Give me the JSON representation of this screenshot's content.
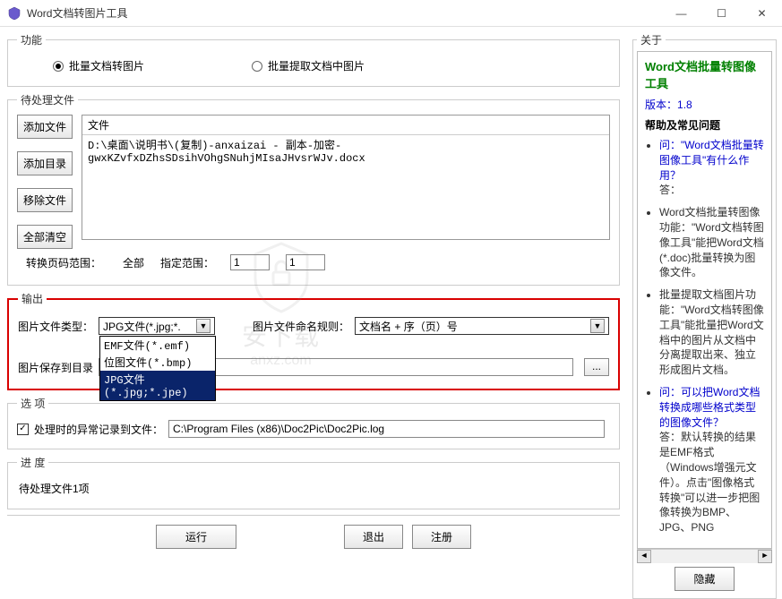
{
  "window": {
    "title": "Word文档转图片工具",
    "min": "—",
    "max": "☐",
    "close": "✕"
  },
  "mode": {
    "legend": "功能",
    "opt_convert": "批量文档转图片",
    "opt_extract": "批量提取文档中图片"
  },
  "pending": {
    "legend": "待处理文件",
    "add_file": "添加文件",
    "add_dir": "添加目录",
    "remove": "移除文件",
    "clear": "全部清空",
    "col_file": "文件",
    "file1": "D:\\桌面\\说明书\\(复制)-anxaizai - 副本-加密-gwxKZvfxDZhsSDsihVOhgSNuhjMIsaJHvsrWJv.docx"
  },
  "range": {
    "label": "转换页码范围：",
    "opt_all": "全部",
    "opt_spec": "指定范围：",
    "from": "1",
    "to": "1"
  },
  "output": {
    "legend": "输出",
    "type_label": "图片文件类型：",
    "type_value": "JPG文件(*.jpg;*.",
    "dd_emf": "EMF文件(*.emf)",
    "dd_bmp": "位图文件(*.bmp)",
    "dd_jpg": "JPG文件(*.jpg;*.jpe)",
    "rule_label": "图片文件命名规则：",
    "rule_value": "文档名 + 序（页）号",
    "savedir_label": "图片保存到目录",
    "savedir_value": "",
    "browse": "..."
  },
  "options": {
    "legend": "选  项",
    "chk_log": "处理时的异常记录到文件：",
    "log_path": "C:\\Program Files (x86)\\Doc2Pic\\Doc2Pic.log"
  },
  "progress": {
    "legend": "进  度",
    "text": "待处理文件1项"
  },
  "buttons": {
    "run": "运行",
    "exit": "退出",
    "register": "注册"
  },
  "about": {
    "legend": "关于",
    "title": "Word文档批量转图像工具",
    "version_label": "版本：",
    "version": "1.8",
    "help_section": "帮助及常见问题",
    "q1": "问：\"Word文档批量转图像工具\"有什么作用？",
    "a1_1": "答：",
    "a1_2": "Word文档批量转图像功能：\"Word文档转图像工具\"能把Word文档(*.doc)批量转换为图像文件。",
    "a1_3": "批量提取文档图片功能：\"Word文档转图像工具\"能批量把Word文档中的图片从文档中分离提取出来、独立形成图片文档。",
    "q2": "问：可以把Word文档转换成哪些格式类型的图像文件？",
    "a2": "答：默认转换的结果是EMF格式（Windows增强元文件）。点击\"图像格式转换\"可以进一步把图像转换为BMP、JPG、PNG",
    "hide": "隐藏"
  },
  "watermark": {
    "text": "安下载",
    "sub": "anxz.com"
  }
}
